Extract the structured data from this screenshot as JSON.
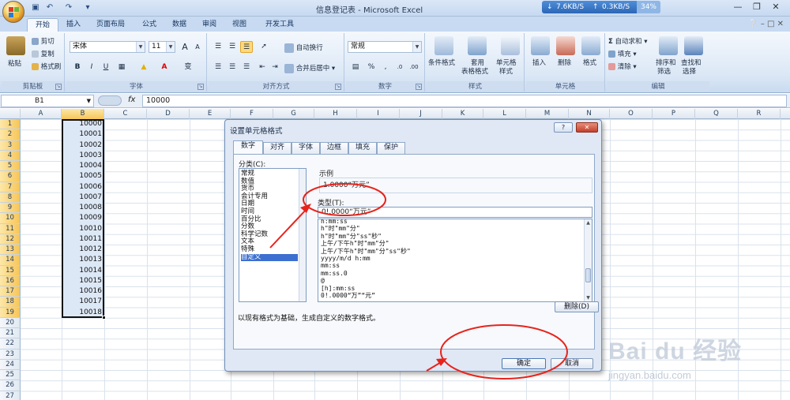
{
  "window": {
    "title": "信息登记表 - Microsoft Excel",
    "minimize": "—",
    "restore": "❐",
    "close": "✕"
  },
  "net_meter": {
    "down": "7.6KB/S",
    "up": "0.3KB/S",
    "percent": "34%"
  },
  "ribbon_tabs": [
    "开始",
    "插入",
    "页面布局",
    "公式",
    "数据",
    "审阅",
    "视图",
    "开发工具"
  ],
  "clipboard": {
    "paste": "粘贴",
    "cut": "剪切",
    "copy": "复制",
    "format_painter": "格式刷",
    "label": "剪贴板"
  },
  "font": {
    "name": "宋体",
    "size": "11",
    "grow": "A",
    "shrink": "A",
    "bold": "B",
    "italic": "I",
    "underline": "U",
    "label": "字体",
    "wen": "变"
  },
  "alignment": {
    "wrap": "自动换行",
    "merge": "合并后居中",
    "label": "对齐方式"
  },
  "number": {
    "format": "常规",
    "percent": "%",
    "comma": ",",
    "label": "数字"
  },
  "styles": {
    "conditional": "条件格式",
    "table_format": "套用\n表格格式",
    "table_line1": "套用",
    "table_line2": "表格格式",
    "cell_styles_1": "单元格",
    "cell_styles_2": "样式",
    "label": "样式"
  },
  "cells": {
    "insert": "插入",
    "delete": "删除",
    "format": "格式",
    "label": "单元格"
  },
  "editing": {
    "autosum": "自动求和",
    "fill": "填充",
    "clear": "清除",
    "sort_1": "排序和",
    "sort_2": "筛选",
    "find_1": "查找和",
    "find_2": "选择",
    "label": "编辑"
  },
  "formula_bar": {
    "cell_ref": "B1",
    "fx": "fx",
    "value": "10000"
  },
  "columns": [
    "A",
    "B",
    "C",
    "D",
    "E",
    "F",
    "G",
    "H",
    "I",
    "J",
    "K",
    "L",
    "M",
    "N",
    "O",
    "P",
    "Q",
    "R"
  ],
  "rows": [
    "1",
    "2",
    "3",
    "4",
    "5",
    "6",
    "7",
    "8",
    "9",
    "10",
    "11",
    "12",
    "13",
    "14",
    "15",
    "16",
    "17",
    "18",
    "19",
    "20",
    "21",
    "22",
    "23",
    "24",
    "25",
    "26",
    "27"
  ],
  "b_values": [
    "10000",
    "10001",
    "10002",
    "10003",
    "10004",
    "10005",
    "10006",
    "10007",
    "10008",
    "10009",
    "10010",
    "10011",
    "10012",
    "10013",
    "10014",
    "10015",
    "10016",
    "10017",
    "10018"
  ],
  "dialog": {
    "title": "设置单元格格式",
    "help": "?",
    "close": "✕",
    "tabs": [
      "数字",
      "对齐",
      "字体",
      "边框",
      "填充",
      "保护"
    ],
    "category_label": "分类(C):",
    "categories": [
      "常规",
      "数值",
      "货币",
      "会计专用",
      "日期",
      "时间",
      "百分比",
      "分数",
      "科学记数",
      "文本",
      "特殊",
      "自定义"
    ],
    "sample_label": "示例",
    "sample_value": "1.0000“万元”",
    "type_label": "类型(T):",
    "type_value": "0!.0000“万元”",
    "formats": [
      "h:mm:ss",
      "h\"时\"mm\"分\"",
      "h\"时\"mm\"分\"ss\"秒\"",
      "上午/下午h\"时\"mm\"分\"",
      "上午/下午h\"时\"mm\"分\"ss\"秒\"",
      "yyyy/m/d h:mm",
      "mm:ss",
      "mm:ss.0",
      "@",
      "[h]:mm:ss",
      "0!.0000“万”“元”"
    ],
    "delete": "删除(D)",
    "description": "以现有格式为基础，生成自定义的数字格式。",
    "ok": "确定",
    "cancel": "取消"
  },
  "watermark": {
    "main": "Bai du 经验",
    "sub": "jingyan.baidu.com"
  }
}
